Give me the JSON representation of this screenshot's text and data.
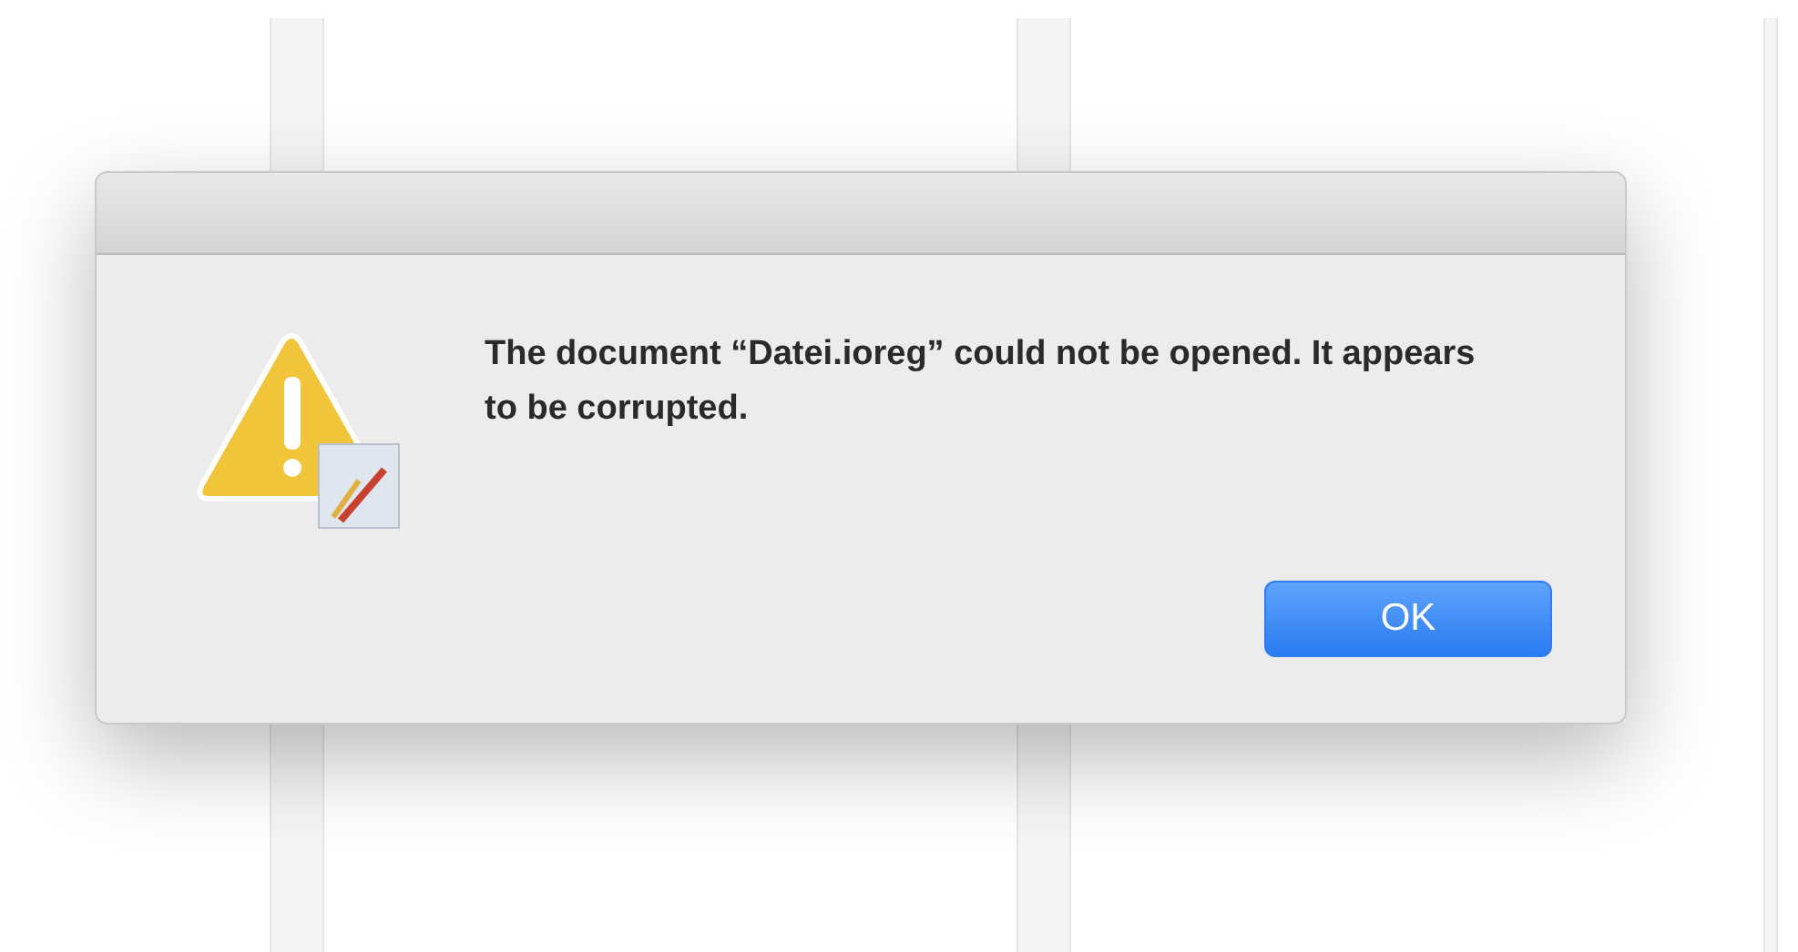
{
  "dialog": {
    "message": "The document “Datei.ioreg” could not be opened. It appears to be corrupted.",
    "buttons": [
      {
        "label": "OK",
        "default": true
      }
    ]
  }
}
